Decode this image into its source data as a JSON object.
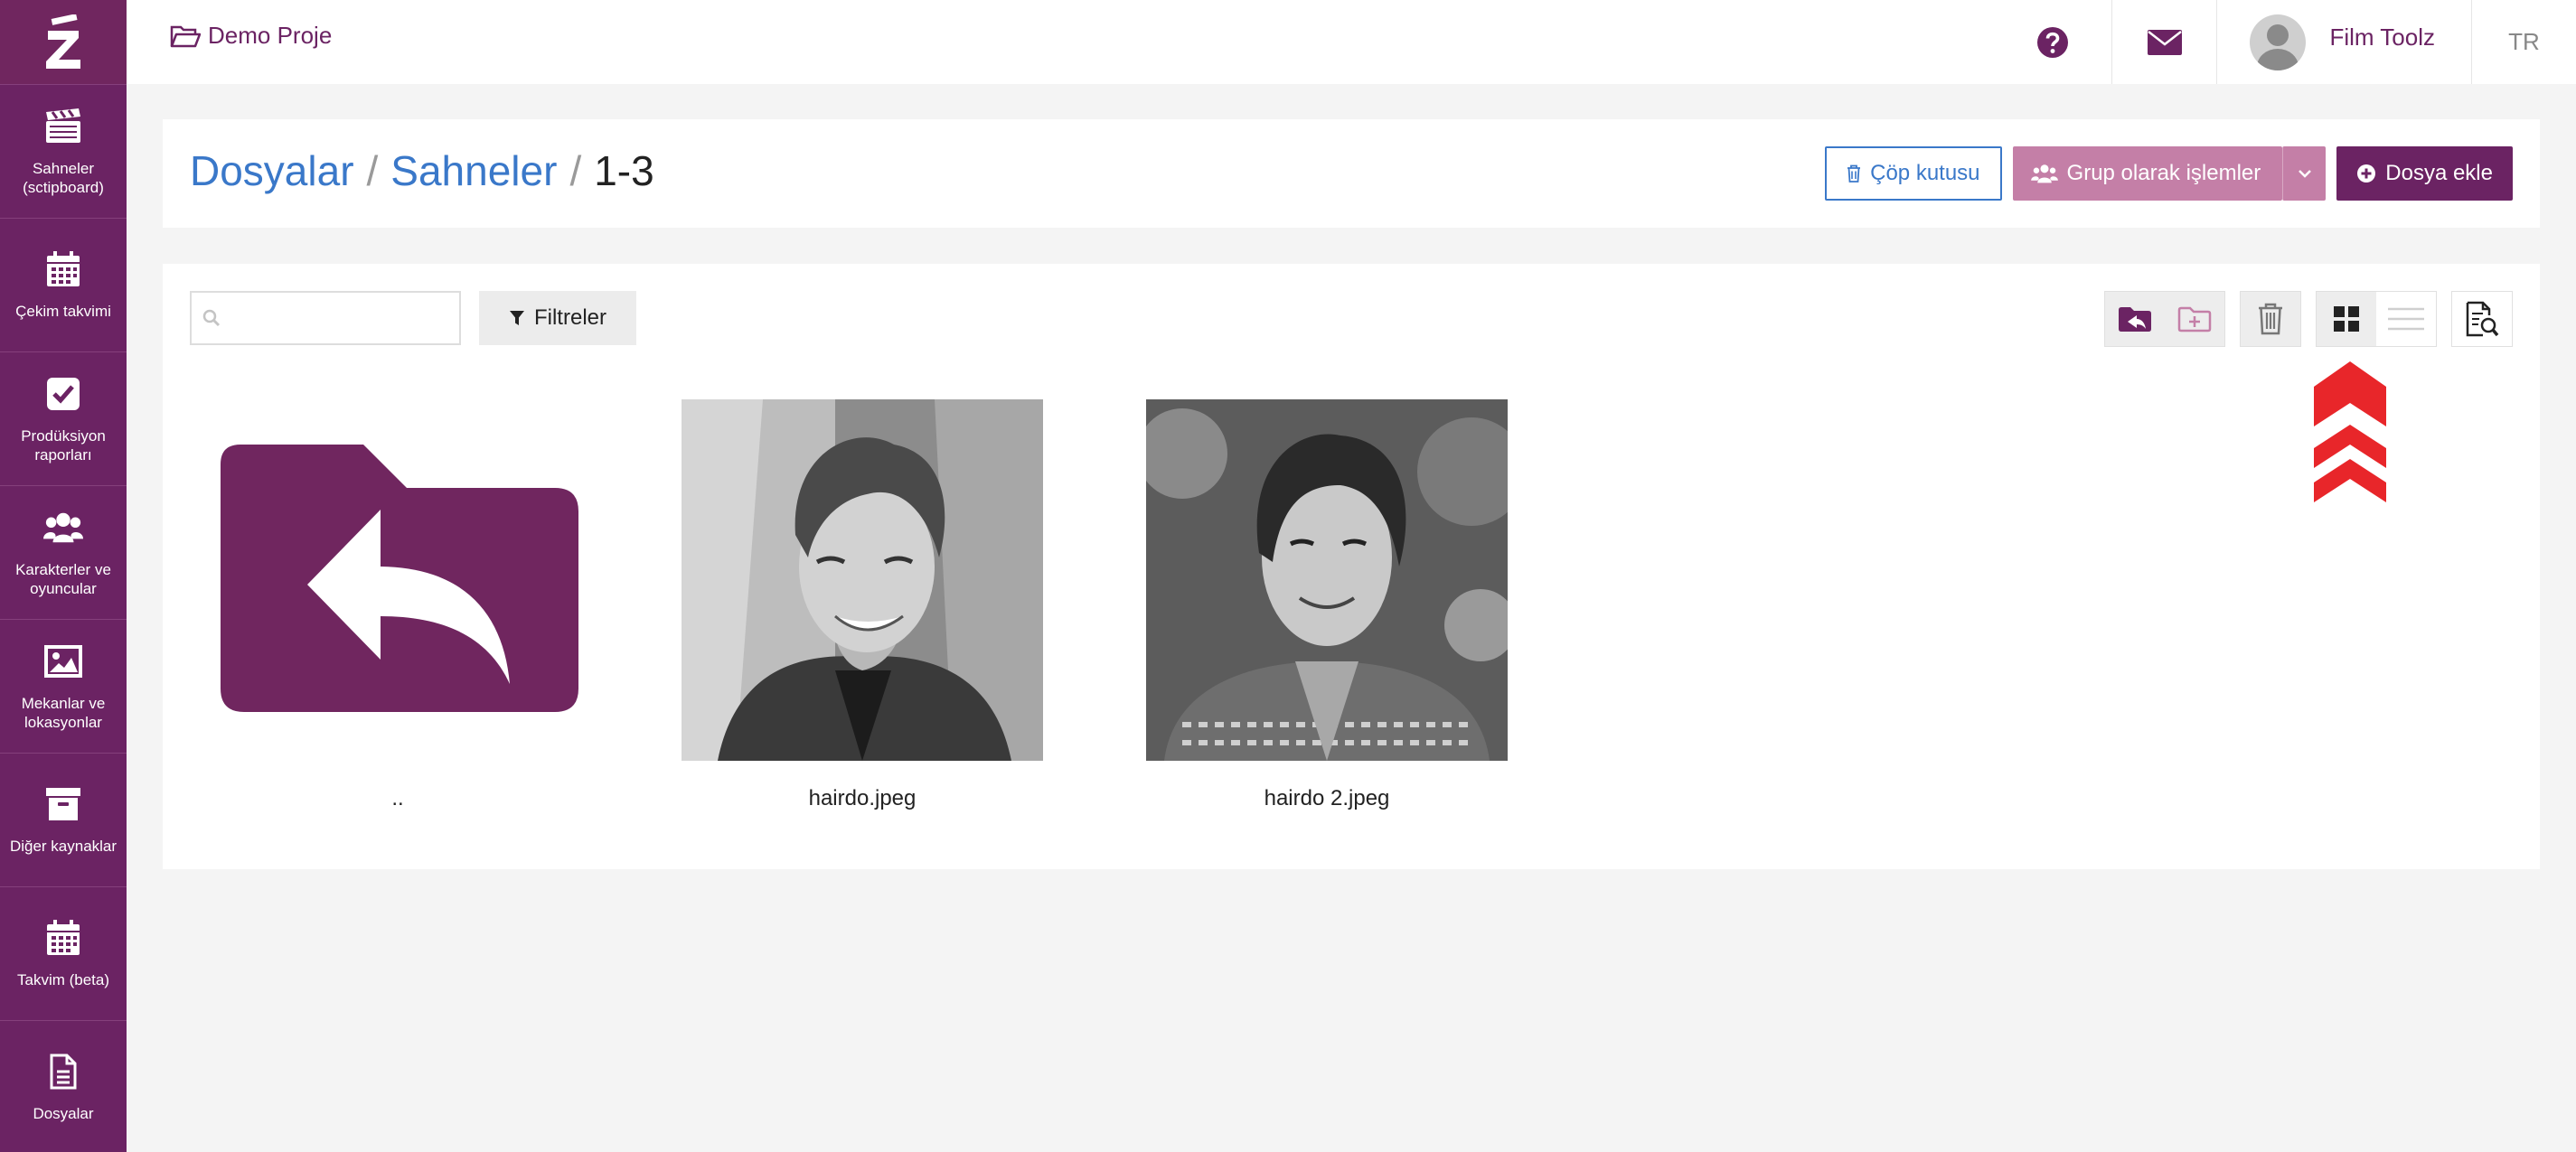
{
  "app": {
    "brand_letter": "Z"
  },
  "sidebar": {
    "items": [
      {
        "label": "Sahneler\n(sctipboard)",
        "icon": "clapperboard-icon"
      },
      {
        "label": "Çekim takvimi",
        "icon": "calendar-icon"
      },
      {
        "label": "Prodüksiyon\nraporları",
        "icon": "checkbox-icon"
      },
      {
        "label": "Karakterler ve\noyuncular",
        "icon": "users-icon"
      },
      {
        "label": "Mekanlar ve\nlokasyonlar",
        "icon": "image-icon"
      },
      {
        "label": "Diğer kaynaklar",
        "icon": "archive-icon"
      },
      {
        "label": "Takvim (beta)",
        "icon": "calendar-icon"
      },
      {
        "label": "Dosyalar",
        "icon": "document-icon"
      }
    ]
  },
  "topbar": {
    "project": "Demo Proje",
    "user_name": "Film Toolz",
    "language": "TR"
  },
  "header": {
    "breadcrumb": [
      "Dosyalar",
      "Sahneler",
      "1-3"
    ],
    "trash_label": "Çöp kutusu",
    "group_label": "Grup olarak işlemler",
    "add_label": "Dosya ekle"
  },
  "main": {
    "search_value": "",
    "search_placeholder": "",
    "filter_label": "Filtreler",
    "files": [
      {
        "name": "..",
        "type": "parent-folder"
      },
      {
        "name": "hairdo.jpeg",
        "type": "image"
      },
      {
        "name": "hairdo 2.jpeg",
        "type": "image"
      }
    ]
  },
  "colors": {
    "brand": "#6b2363",
    "brand_light": "#c47fa7",
    "link": "#3a78c9",
    "annotation": "#e8262a"
  }
}
